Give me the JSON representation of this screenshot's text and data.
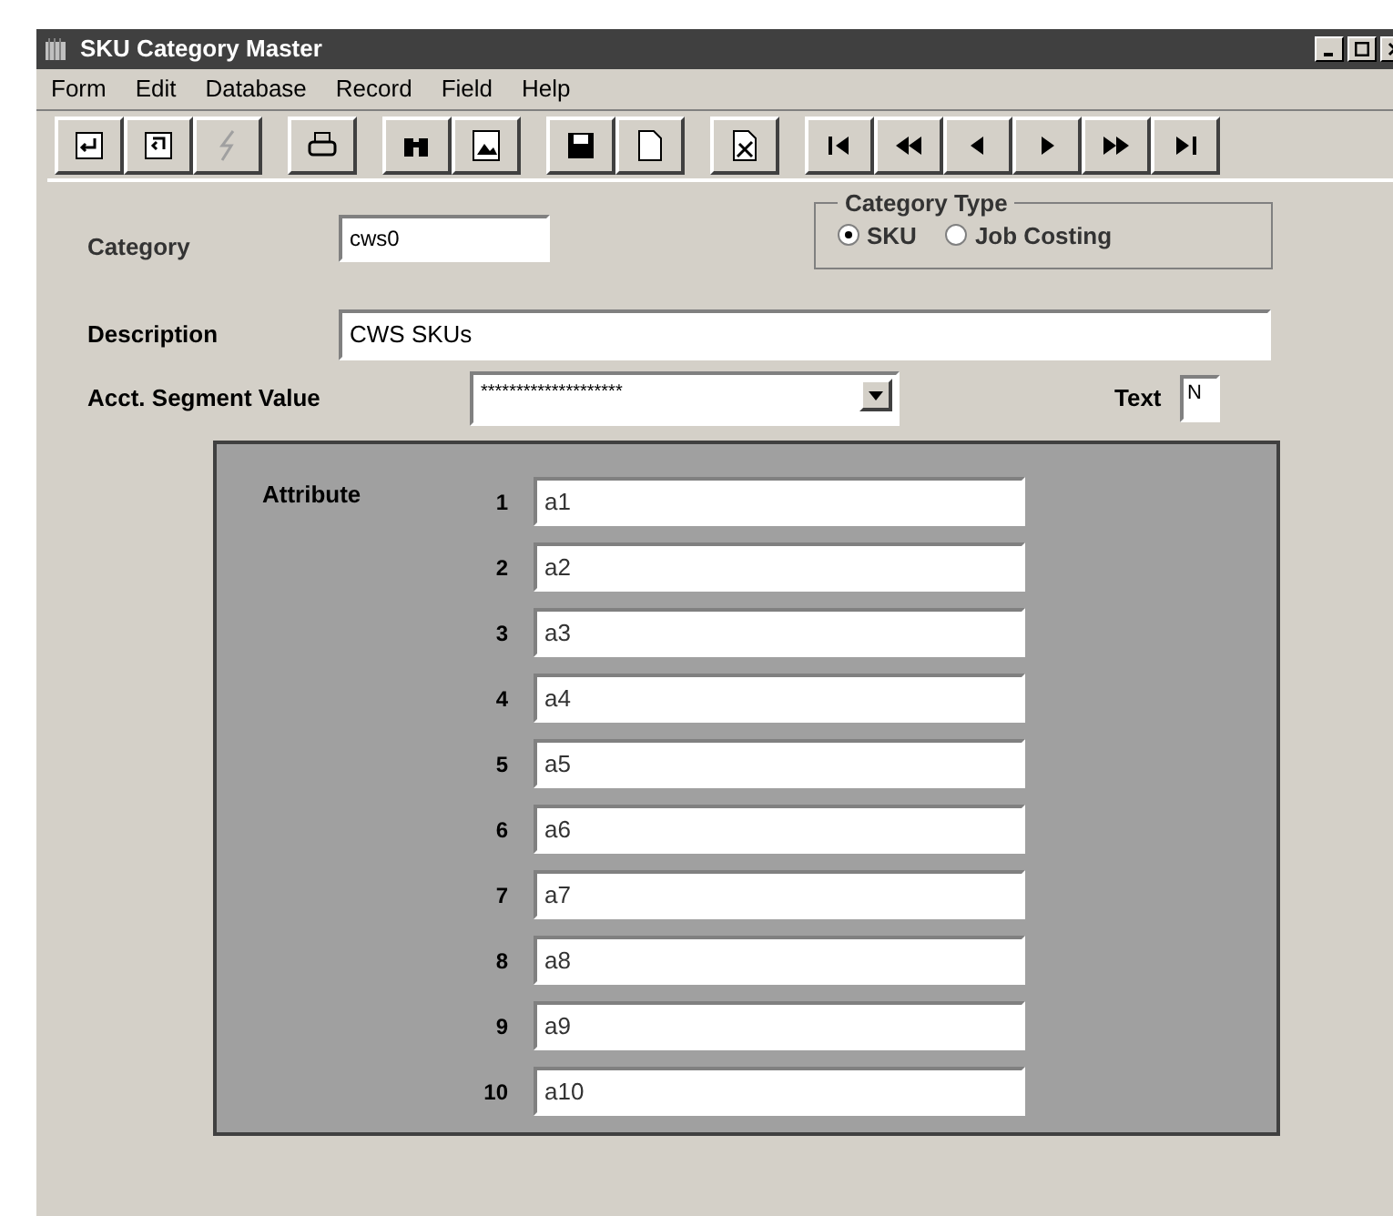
{
  "window": {
    "title": "SKU Category Master"
  },
  "menu": [
    {
      "label": "Form"
    },
    {
      "label": "Edit"
    },
    {
      "label": "Database"
    },
    {
      "label": "Record"
    },
    {
      "label": "Field"
    },
    {
      "label": "Help"
    }
  ],
  "toolbar": [
    {
      "kind": "enter",
      "disabled": false
    },
    {
      "kind": "exit",
      "disabled": false
    },
    {
      "kind": "execute",
      "disabled": true
    },
    {
      "kind": "print",
      "disabled": false
    },
    {
      "kind": "find",
      "disabled": false
    },
    {
      "kind": "view",
      "disabled": false
    },
    {
      "kind": "save",
      "disabled": false
    },
    {
      "kind": "new",
      "disabled": false
    },
    {
      "kind": "delete",
      "disabled": false
    },
    {
      "kind": "first",
      "disabled": false
    },
    {
      "kind": "prevpage",
      "disabled": false
    },
    {
      "kind": "prev",
      "disabled": false
    },
    {
      "kind": "next",
      "disabled": false
    },
    {
      "kind": "nextpage",
      "disabled": false
    },
    {
      "kind": "last",
      "disabled": false
    }
  ],
  "category": {
    "label": "Category",
    "value": "cws0"
  },
  "category_type": {
    "title": "Category Type",
    "options": [
      {
        "label": "SKU",
        "selected": true
      },
      {
        "label": "Job Costing",
        "selected": false
      }
    ]
  },
  "description": {
    "label": "Description",
    "value": "CWS SKUs"
  },
  "acct_segment": {
    "label": "Acct. Segment Value",
    "value": "********************"
  },
  "text": {
    "label": "Text",
    "value": "N"
  },
  "attributes": {
    "label": "Attribute",
    "rows": [
      {
        "number": "1",
        "value": "a1"
      },
      {
        "number": "2",
        "value": "a2"
      },
      {
        "number": "3",
        "value": "a3"
      },
      {
        "number": "4",
        "value": "a4"
      },
      {
        "number": "5",
        "value": "a5"
      },
      {
        "number": "6",
        "value": "a6"
      },
      {
        "number": "7",
        "value": "a7"
      },
      {
        "number": "8",
        "value": "a8"
      },
      {
        "number": "9",
        "value": "a9"
      },
      {
        "number": "10",
        "value": "a10"
      }
    ]
  }
}
